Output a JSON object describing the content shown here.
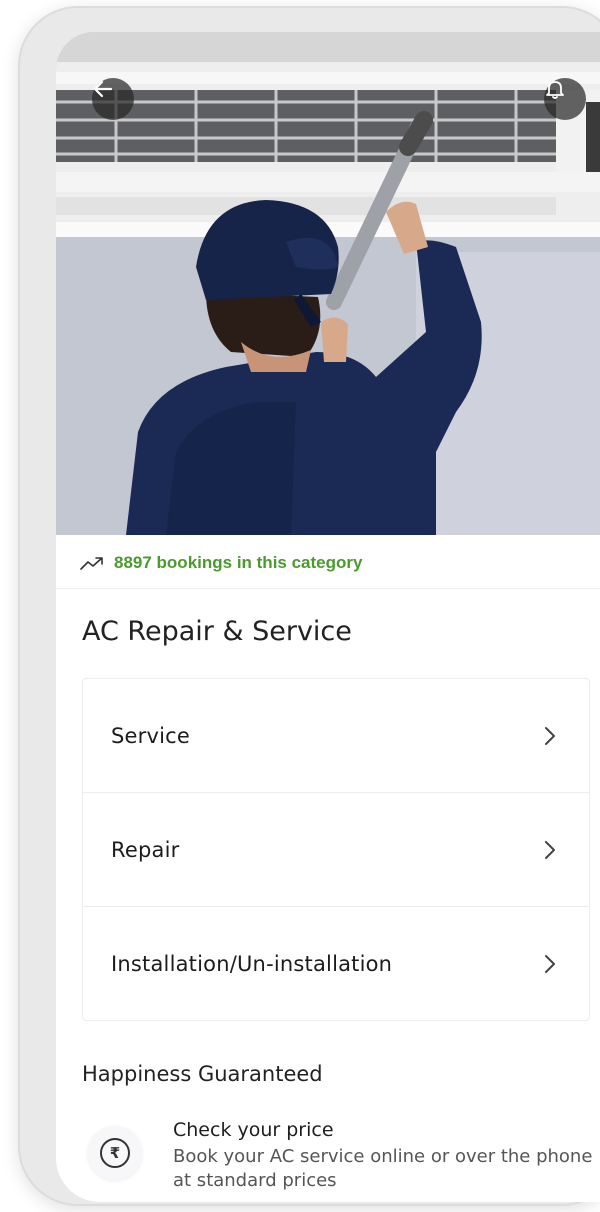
{
  "header": {
    "back_icon": "arrow-left-icon",
    "bell_icon": "bell-icon"
  },
  "hero": {
    "image_alt": "Technician cleaning an air conditioner"
  },
  "bookings": {
    "icon": "trending-up-icon",
    "text": "8897 bookings in this category",
    "color": "#4a9a2e"
  },
  "category": {
    "title": "AC Repair & Service"
  },
  "options": [
    {
      "label": "Service"
    },
    {
      "label": "Repair"
    },
    {
      "label": "Installation/Un-installation"
    }
  ],
  "happiness": {
    "title": "Happiness Guaranteed",
    "items": [
      {
        "icon": "rupee-icon",
        "title": "Check your price",
        "description": "Book your AC service online or over the phone at standard prices"
      }
    ]
  }
}
